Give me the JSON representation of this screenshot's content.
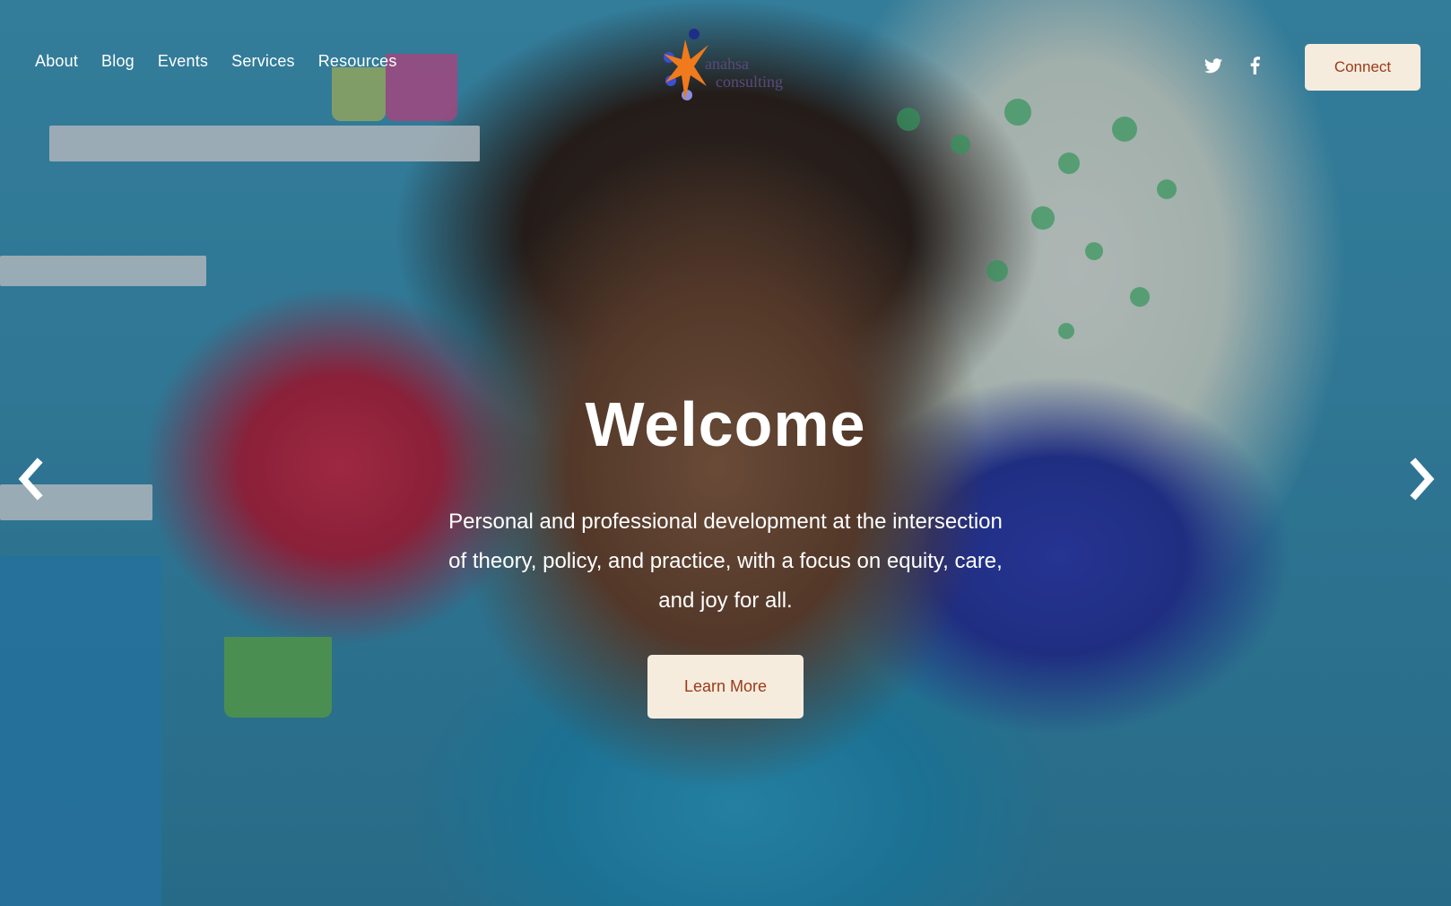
{
  "nav": {
    "items": [
      {
        "label": "About"
      },
      {
        "label": "Blog"
      },
      {
        "label": "Events"
      },
      {
        "label": "Services"
      },
      {
        "label": "Resources"
      }
    ]
  },
  "logo": {
    "line1": "anahsa",
    "line2": "consulting"
  },
  "social": {
    "icons": [
      "twitter-icon",
      "facebook-icon"
    ]
  },
  "header": {
    "connect_label": "Connect"
  },
  "hero": {
    "title": "Welcome",
    "subtitle": "Personal and professional development at the intersection of theory, policy, and practice, with a focus on equity, care, and joy for all.",
    "cta_label": "Learn More"
  },
  "slider": {
    "prev_icon": "chevron-left-icon",
    "next_icon": "chevron-right-icon"
  },
  "colors": {
    "button_bg": "#f6ecdd",
    "button_text": "#9a3a1a",
    "logo_orange": "#f07a1c",
    "logo_blue": "#1f2d8a"
  }
}
